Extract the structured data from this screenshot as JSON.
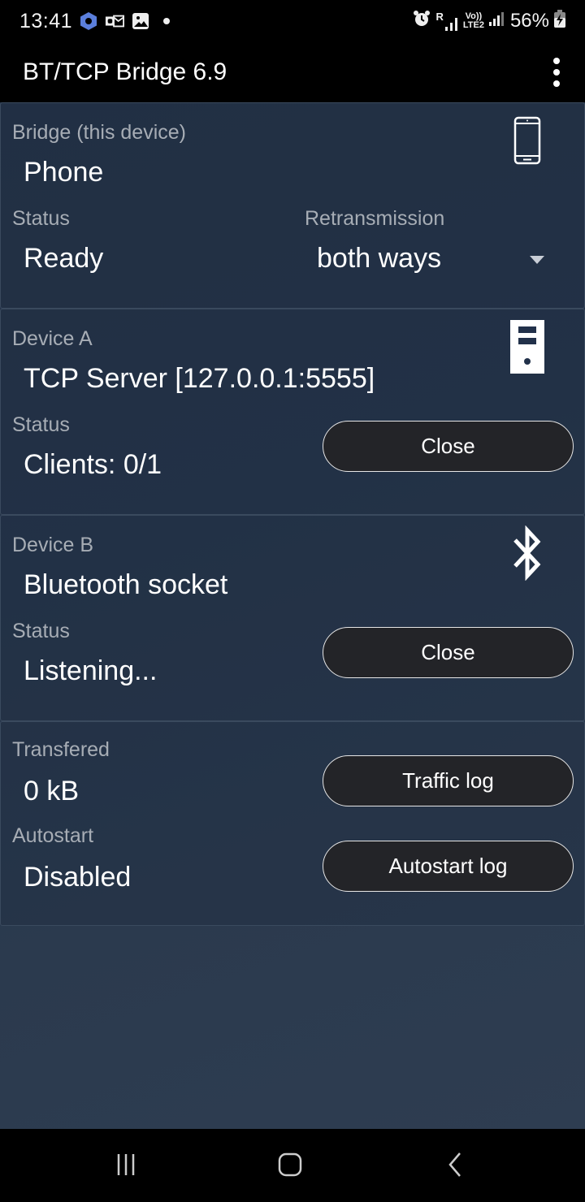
{
  "status_bar": {
    "time": "13:41",
    "left_icons": [
      "app-notification-icon",
      "outlook-icon",
      "gallery-icon",
      "more-dot-icon"
    ],
    "right_icons": [
      "alarm-icon",
      "roaming-signal-icon",
      "volte-lte2-icon",
      "signal-icon",
      "battery-charging-icon"
    ],
    "roaming_label": "R",
    "volte_label": "Vo))",
    "lte_label": "LTE2",
    "battery_percent": "56%"
  },
  "app_bar": {
    "title": "BT/TCP Bridge 6.9",
    "menu_icon": "overflow-menu-icon"
  },
  "bridge_card": {
    "label": "Bridge (this device)",
    "device": "Phone",
    "icon": "phone-icon",
    "status_label": "Status",
    "status_value": "Ready",
    "retransmission_label": "Retransmission",
    "retransmission_value": "both ways"
  },
  "device_a_card": {
    "label": "Device A",
    "device": "TCP Server [127.0.0.1:5555]",
    "icon": "server-icon",
    "status_label": "Status",
    "status_value": "Clients: 0/1",
    "button_label": "Close"
  },
  "device_b_card": {
    "label": "Device B",
    "device": "Bluetooth socket",
    "icon": "bluetooth-icon",
    "status_label": "Status",
    "status_value": "Listening...",
    "button_label": "Close"
  },
  "stats_card": {
    "transfered_label": "Transfered",
    "transfered_value": "0 kB",
    "traffic_button": "Traffic log",
    "autostart_label": "Autostart",
    "autostart_value": "Disabled",
    "autostart_button": "Autostart log"
  },
  "nav_bar": {
    "buttons": [
      "recents-icon",
      "home-icon",
      "back-icon"
    ]
  }
}
